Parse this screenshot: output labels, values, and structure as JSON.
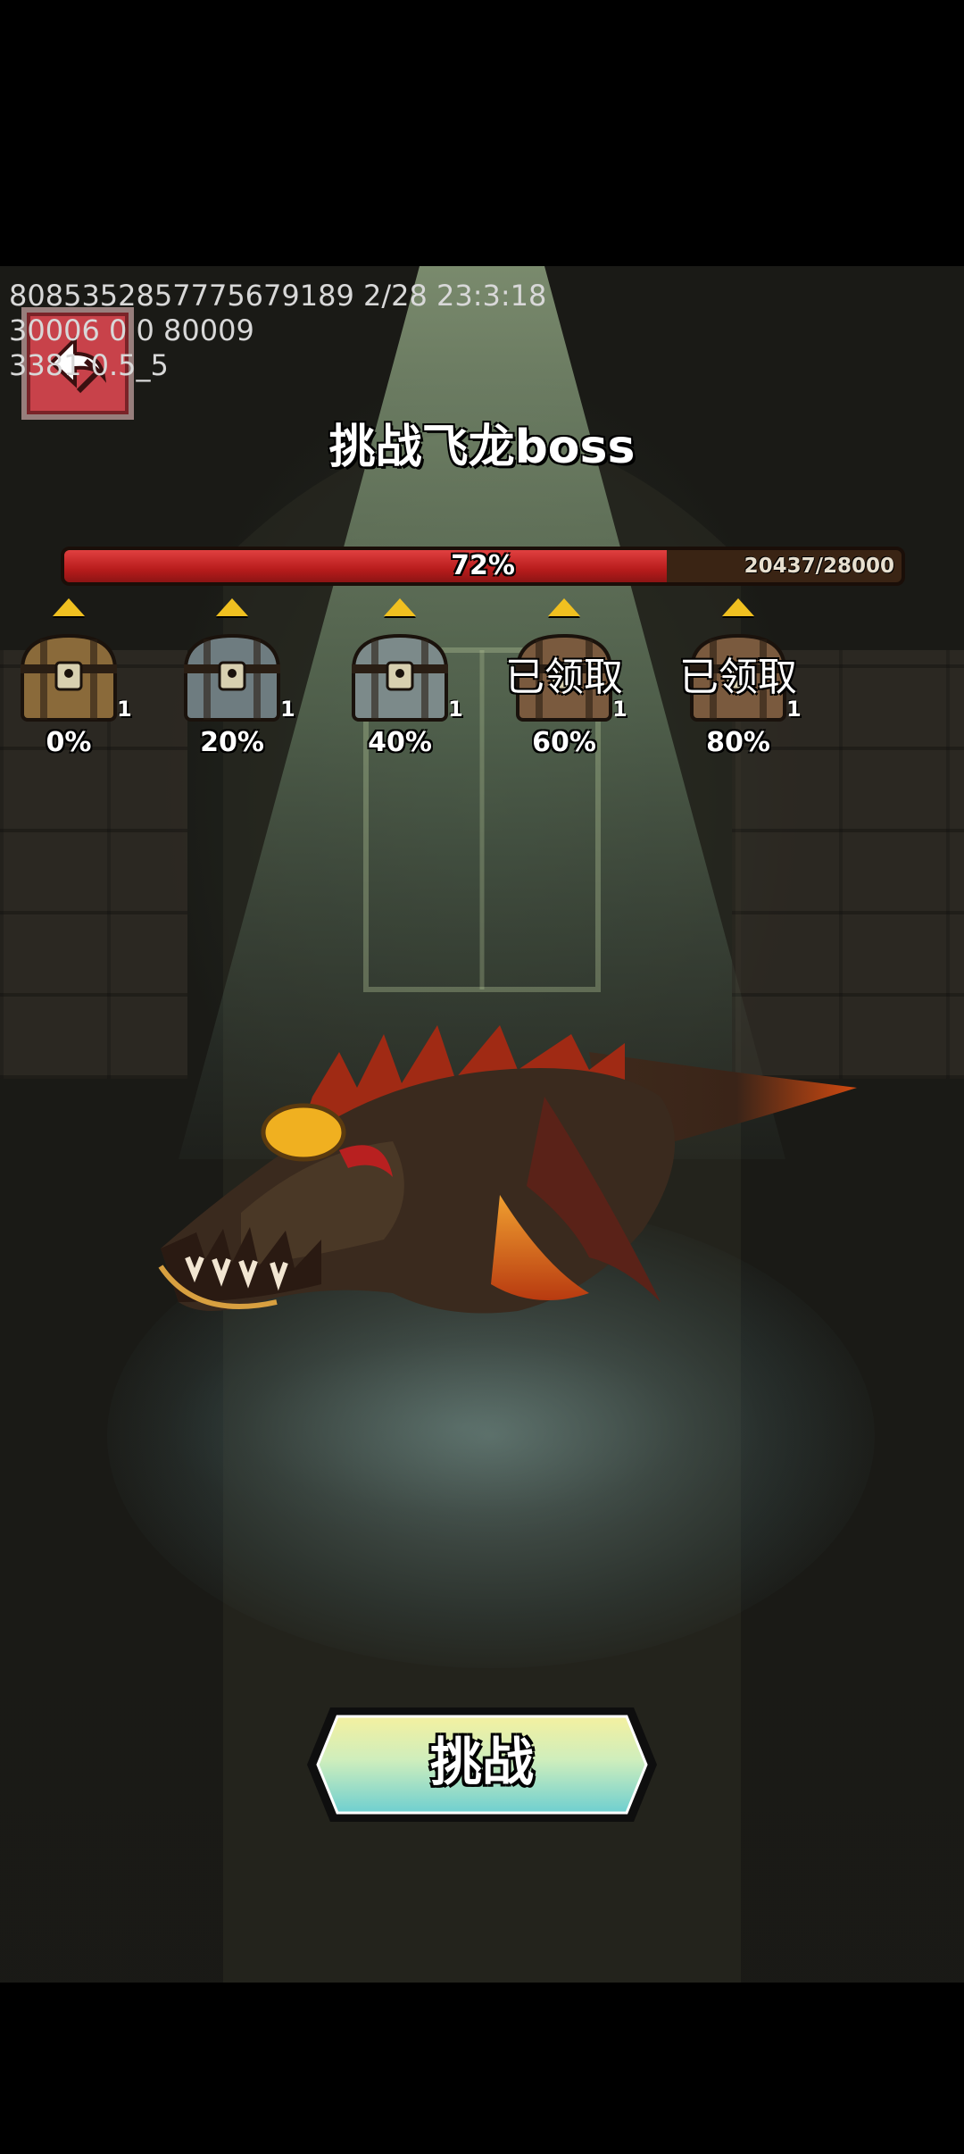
{
  "debug": {
    "line1": "8085352857775679189 2/28 23:3:18",
    "line2": "30006 0 0 80009",
    "line3": "3381 0.5_5"
  },
  "page": {
    "title": "挑战飞龙boss"
  },
  "progress": {
    "fraction": 0.72,
    "percent_label": "72%",
    "count_label": "20437/28000"
  },
  "milestones": [
    {
      "percent": "0%",
      "count": "1",
      "claimed_label": "",
      "chest_color": "#8a6a3a"
    },
    {
      "percent": "20%",
      "count": "1",
      "claimed_label": "",
      "chest_color": "#6e7c80"
    },
    {
      "percent": "40%",
      "count": "1",
      "claimed_label": "",
      "chest_color": "#7c8a8a"
    },
    {
      "percent": "60%",
      "count": "1",
      "claimed_label": "已领取",
      "chest_color": "#7a5a3e"
    },
    {
      "percent": "80%",
      "count": "1",
      "claimed_label": "已领取",
      "chest_color": "#7a5a3e"
    }
  ],
  "actions": {
    "challenge_label": "挑战"
  },
  "colors": {
    "accent_red": "#c8424a",
    "progress_red": "#d02828",
    "button_teal": "#9ee0d6",
    "button_yellow": "#f4f0a0"
  }
}
